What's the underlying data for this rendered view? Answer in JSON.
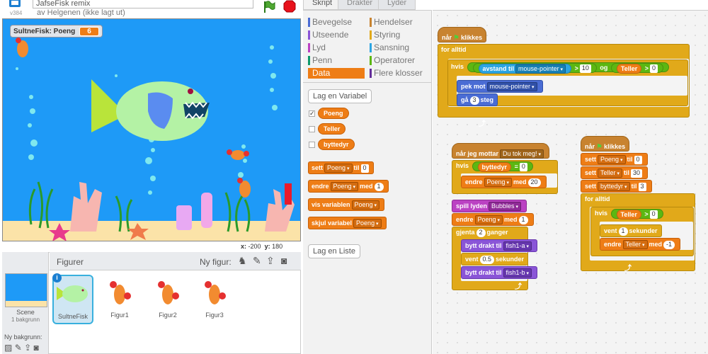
{
  "header": {
    "project_title": "JafseFisk remix",
    "author_line": "av Helgenen (ikke lagt ut)",
    "version": "v384"
  },
  "stage": {
    "monitor_label": "SultneFisk: Poeng",
    "monitor_value": "6",
    "x_label": "x:",
    "x_value": "-200",
    "y_label": "y:",
    "y_value": "180"
  },
  "sprites": {
    "header_label": "Figurer",
    "new_sprite_label": "Ny figur:",
    "scene_label": "Scene",
    "scene_sub": "1 bakgrunn",
    "new_backdrop_label": "Ny bakgrunn:",
    "items": [
      {
        "name": "SultneFisk"
      },
      {
        "name": "Figur1"
      },
      {
        "name": "Figur2"
      },
      {
        "name": "Figur3"
      }
    ]
  },
  "tabs": [
    "Skript",
    "Drakter",
    "Lyder"
  ],
  "categories": [
    {
      "label": "Bevegelse",
      "color": "#4a6cd4"
    },
    {
      "label": "Hendelser",
      "color": "#c88330"
    },
    {
      "label": "Utseende",
      "color": "#8a55d7"
    },
    {
      "label": "Styring",
      "color": "#e1a91a"
    },
    {
      "label": "Lyd",
      "color": "#bb42c3"
    },
    {
      "label": "Sansning",
      "color": "#2ca5e2"
    },
    {
      "label": "Penn",
      "color": "#0e9a6c"
    },
    {
      "label": "Operatorer",
      "color": "#5cb712"
    },
    {
      "label": "Data",
      "color": "#ee7d16"
    },
    {
      "label": "Flere klosser",
      "color": "#632d99"
    }
  ],
  "palette": {
    "make_variable": "Lag en Variabel",
    "make_list": "Lag en Liste",
    "variables": [
      {
        "name": "Poeng",
        "checked": true
      },
      {
        "name": "Teller",
        "checked": false
      },
      {
        "name": "byttedyr",
        "checked": false
      }
    ],
    "blocks": {
      "set_a": "sett",
      "set_var": "Poeng",
      "set_b": "til",
      "set_val": "0",
      "change_a": "endre",
      "change_var": "Poeng",
      "change_b": "med",
      "change_val": "1",
      "show_a": "vis variablen",
      "show_var": "Poeng",
      "hide_a": "skjul variabel",
      "hide_var": "Poeng"
    }
  },
  "script1": {
    "hat": "når",
    "hat_b": "klikkes",
    "forever": "for alltid",
    "if": "hvis",
    "distance": "avstand til",
    "distance_target": "mouse-pointer",
    "gt": ">",
    "dist_val": "10",
    "and": "og",
    "teller": "Teller",
    "gt2": ">",
    "teller_val": "0",
    "point": "pek mot",
    "point_target": "mouse-pointer",
    "move_a": "gå",
    "move_val": "3",
    "move_b": "steg"
  },
  "script2": {
    "hat": "når jeg mottar",
    "msg": "Du tok meg!",
    "if": "hvis",
    "var": "byttedyr",
    "eq": "=",
    "eq_val": "0",
    "change_a": "endre",
    "change_var": "Poeng",
    "change_b": "med",
    "change_val": "20",
    "sound_a": "spill lyden",
    "sound": "Bubbles",
    "change2_a": "endre",
    "change2_var": "Poeng",
    "change2_b": "med",
    "change2_val": "1",
    "repeat_a": "gjenta",
    "repeat_val": "2",
    "repeat_b": "ganger",
    "cos1_a": "bytt drakt til",
    "cos1": "fish1-a",
    "wait_a": "vent",
    "wait_val": "0.5",
    "wait_b": "sekunder",
    "cos2_a": "bytt drakt til",
    "cos2": "fish1-b"
  },
  "script3": {
    "hat": "når",
    "hat_b": "klikkes",
    "set1_a": "sett",
    "set1_var": "Poeng",
    "set1_b": "til",
    "set1_val": "0",
    "set2_a": "sett",
    "set2_var": "Teller",
    "set2_b": "til",
    "set2_val": "30",
    "set3_a": "sett",
    "set3_var": "byttedyr",
    "set3_b": "til",
    "set3_val": "3",
    "forever": "for alltid",
    "if": "hvis",
    "teller": "Teller",
    "gt": ">",
    "teller_val": "0",
    "wait_a": "vent",
    "wait_val": "1",
    "wait_b": "sekunder",
    "change_a": "endre",
    "change_var": "Teller",
    "change_b": "med",
    "change_val": "-1"
  }
}
